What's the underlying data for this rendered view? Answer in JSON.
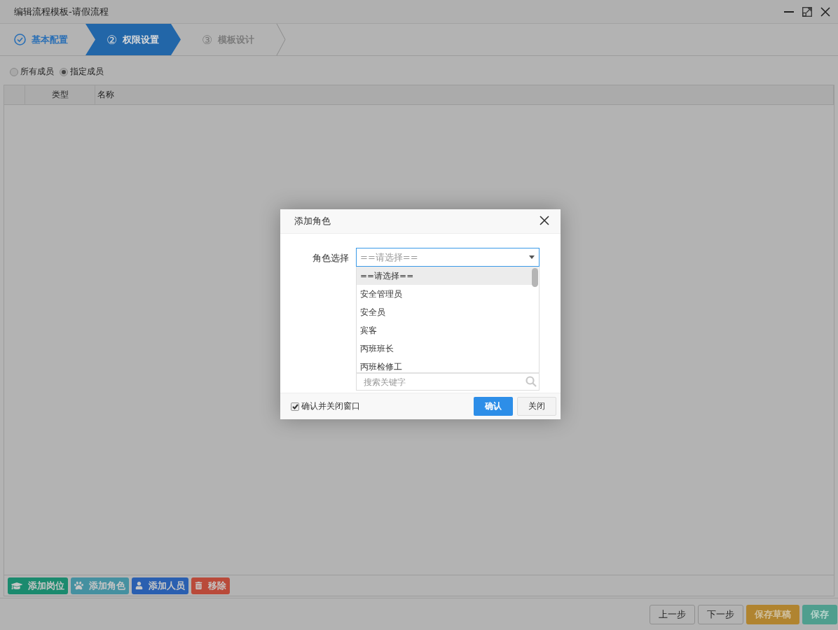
{
  "window": {
    "title": "编辑流程模板-请假流程"
  },
  "steps": [
    {
      "label": "基本配置",
      "completed": true,
      "selected": false
    },
    {
      "number": "②",
      "label": "权限设置",
      "completed": false,
      "selected": true
    },
    {
      "number": "③",
      "label": "模板设计",
      "completed": false,
      "selected": false
    }
  ],
  "scope": [
    {
      "label": "所有成员",
      "selected": false
    },
    {
      "label": "指定成员",
      "selected": true
    }
  ],
  "table": {
    "columns": [
      "类型",
      "名称"
    ]
  },
  "toolbar": [
    {
      "label": "添加岗位",
      "kind": "post",
      "color": "#1b8a6e"
    },
    {
      "label": "添加角色",
      "kind": "role",
      "color": "#4590a0"
    },
    {
      "label": "添加人员",
      "kind": "person",
      "color": "#2a5fb0"
    },
    {
      "label": "移除",
      "kind": "remove",
      "color": "#b94a3a"
    }
  ],
  "footer": [
    {
      "label": "上一步",
      "kind": "plain"
    },
    {
      "label": "下一步",
      "kind": "plain"
    },
    {
      "label": "保存草稿",
      "kind": "draft"
    },
    {
      "label": "保存",
      "kind": "save"
    }
  ],
  "dialog": {
    "title": "添加角色",
    "field_label": "角色选择",
    "select_value": "==请选择==",
    "options": [
      {
        "label": "==请选择==",
        "selected": true
      },
      {
        "label": "安全管理员",
        "selected": false
      },
      {
        "label": "安全员",
        "selected": false
      },
      {
        "label": "宾客",
        "selected": false
      },
      {
        "label": "丙班班长",
        "selected": false
      },
      {
        "label": "丙班检修工",
        "selected": false
      }
    ],
    "search_placeholder": "搜索关键字",
    "close_after": {
      "label": "确认并关闭窗口",
      "checked": true
    },
    "buttons": [
      {
        "label": "确认",
        "kind": "primary"
      },
      {
        "label": "关闭",
        "kind": "plain"
      }
    ]
  }
}
